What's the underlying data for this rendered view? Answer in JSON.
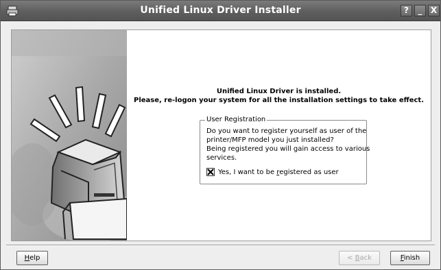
{
  "window": {
    "title": "Unified Linux Driver Installer",
    "controls": {
      "help": "?",
      "minimize": "_",
      "close": "X"
    }
  },
  "main": {
    "message_line1": "Unified Linux Driver is installed.",
    "message_line2": "Please, re-logon your system for all the installation settings to take effect."
  },
  "registration": {
    "legend": "User Registration",
    "lines": [
      "Do you want to register yourself as user of the",
      "printer/MFP model you just installed?",
      "Being registered you will gain access to various",
      "services."
    ],
    "checkbox": {
      "checked": true,
      "label_prefix": "Yes, I want to be ",
      "label_mnemonic": "r",
      "label_suffix": "egistered as user"
    }
  },
  "buttons": {
    "help": {
      "mnemonic": "H",
      "rest": "elp"
    },
    "back": {
      "prefix": "< ",
      "mnemonic": "B",
      "rest": "ack"
    },
    "finish": {
      "mnemonic": "F",
      "rest": "inish"
    }
  }
}
